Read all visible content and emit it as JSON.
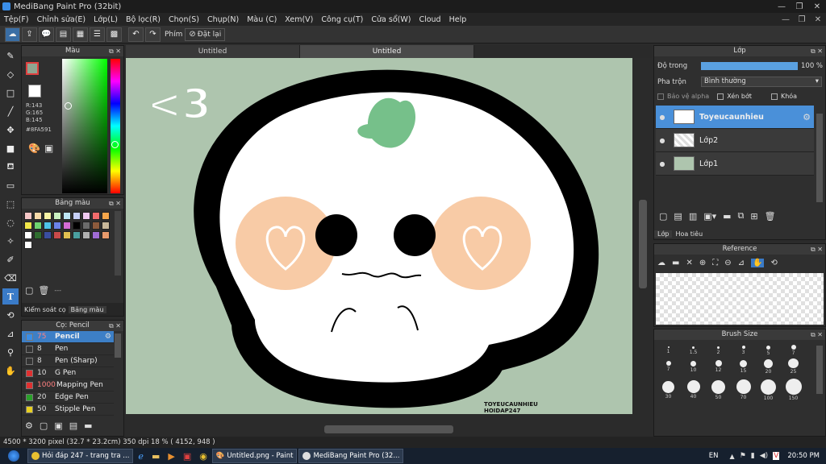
{
  "window": {
    "title": "MediBang Paint Pro (32bit)"
  },
  "menu": [
    "Tệp(F)",
    "Chỉnh sửa(E)",
    "Lớp(L)",
    "Bộ lọc(R)",
    "Chọn(S)",
    "Chụp(N)",
    "Màu (C)",
    "Xem(V)",
    "Công cụ(T)",
    "Cửa sổ(W)",
    "Cloud",
    "Help"
  ],
  "toolbar": {
    "key_label": "Phím",
    "reset_label": "Đặt lại"
  },
  "tabs": [
    "Untitled",
    "Untitled"
  ],
  "color_panel": {
    "title": "Màu",
    "r": "R:143",
    "g": "G:165",
    "b": "B:145",
    "hex": "#8FA591",
    "current_color": "#8fa591"
  },
  "palette_panel": {
    "title": "Bảng màu",
    "value": "---",
    "tab1": "Kiểm soát cọ",
    "tab2": "Bảng màu",
    "swatches": [
      "#f5c6c6",
      "#f7d9a8",
      "#f8f3a4",
      "#c9f0c0",
      "#bde6f5",
      "#c6cff7",
      "#f0c8f0",
      "#f26b6b",
      "#f5a64a",
      "#f0e64a",
      "#6fd46f",
      "#4ec2e8",
      "#6b82e8",
      "#d46bd4",
      "#000000",
      "#6b6b6b",
      "#8c5a3c",
      "#c8b89a",
      "#ffffff",
      "#2f6d2f",
      "#3a4ea0",
      "#c84a4a",
      "#e0c050",
      "#4aa0a0",
      "#b0b0b0",
      "#a06bd4",
      "#e89a6b",
      "#ffffff"
    ]
  },
  "brush_panel": {
    "title": "Cọ: Pencil",
    "brushes": [
      {
        "size": "75",
        "name": "Pencil",
        "color": "#3a8ee8"
      },
      {
        "size": "8",
        "name": "Pen",
        "color": "#333333"
      },
      {
        "size": "8",
        "name": "Pen (Sharp)",
        "color": "#333333"
      },
      {
        "size": "10",
        "name": "G Pen",
        "color": "#e03030"
      },
      {
        "size": "1000",
        "name": "Mapping Pen",
        "color": "#e03030"
      },
      {
        "size": "20",
        "name": "Edge Pen",
        "color": "#2aa02a"
      },
      {
        "size": "50",
        "name": "Stipple Pen",
        "color": "#e8d020"
      }
    ]
  },
  "layer_panel": {
    "title": "Lớp",
    "opacity_label": "Độ trong",
    "opacity_value": "100 %",
    "opacity_fraction": 1.0,
    "blend_label": "Pha trộn",
    "blend_value": "Bình thường",
    "protect_alpha": "Bảo vệ alpha",
    "clipping": "Xén bớt",
    "lock": "Khóa",
    "layers": [
      "Toyeucaunhieu",
      "Lớp2",
      "Lớp1"
    ],
    "tab1": "Lớp",
    "tab2": "Hoa tiêu"
  },
  "reference_panel": {
    "title": "Reference"
  },
  "brush_size_panel": {
    "title": "Brush Size",
    "row1": [
      "1",
      "1.5",
      "2",
      "3",
      "5",
      "7"
    ],
    "row2": [
      "7",
      "10",
      "12",
      "15",
      "20",
      "25"
    ],
    "row3": [
      "30",
      "40",
      "50",
      "70",
      "100",
      "150"
    ]
  },
  "canvas": {
    "note_text": "<3",
    "signature_line1": "TOYEUCAUNHIEU",
    "signature_line2": "HOIDAP247"
  },
  "status": {
    "text": "4500 * 3200 pixel  (32.7 * 23.2cm)  350 dpi  18 %  ( 4152, 948 )"
  },
  "taskbar": {
    "item1": "Hỏi đáp 247 - trang tra ...",
    "item2": "Untitled.png - Paint",
    "item3": "MediBang Paint Pro (32...",
    "lang": "EN",
    "time": "20:50 PM"
  }
}
